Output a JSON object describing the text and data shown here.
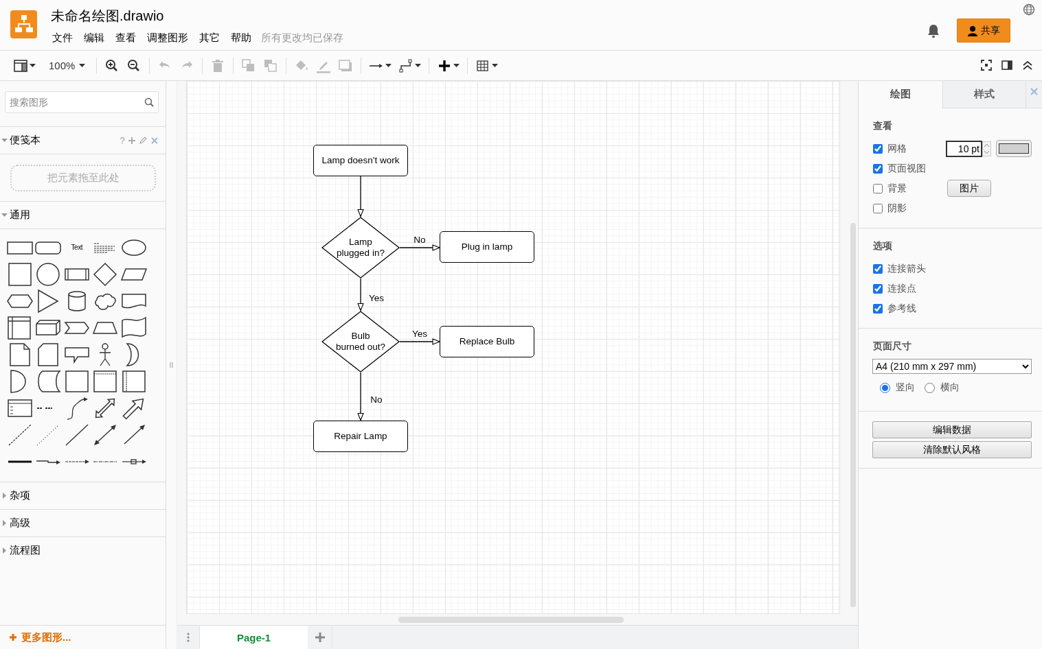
{
  "app": {
    "title": "未命名绘图.drawio",
    "menu": [
      "文件",
      "编辑",
      "查看",
      "调整图形",
      "其它",
      "帮助"
    ],
    "save_status": "所有更改均已保存",
    "share_button": "共享"
  },
  "toolbar": {
    "groups": [
      [
        {
          "kind": "layout",
          "disabled": false
        },
        {
          "kind": "zoom",
          "label": "100%",
          "disabled": false
        }
      ],
      [
        {
          "kind": "zoom-in",
          "disabled": false
        },
        {
          "kind": "zoom-out",
          "disabled": false
        }
      ],
      [
        {
          "kind": "undo",
          "disabled": true
        },
        {
          "kind": "redo",
          "disabled": true
        }
      ],
      [
        {
          "kind": "delete",
          "disabled": true
        }
      ],
      [
        {
          "kind": "to-front",
          "disabled": true
        },
        {
          "kind": "to-back",
          "disabled": true
        }
      ],
      [
        {
          "kind": "fill",
          "disabled": true
        },
        {
          "kind": "line-color",
          "disabled": true
        },
        {
          "kind": "shadow",
          "disabled": true
        }
      ],
      [
        {
          "kind": "connection",
          "disabled": false
        },
        {
          "kind": "waypoint",
          "disabled": false
        }
      ],
      [
        {
          "kind": "insert",
          "disabled": false
        }
      ],
      [
        {
          "kind": "table",
          "disabled": false
        }
      ]
    ],
    "right": [
      {
        "kind": "fullscreen",
        "disabled": false
      },
      {
        "kind": "format-toggle",
        "disabled": false
      },
      {
        "kind": "collapse",
        "disabled": false
      }
    ]
  },
  "sidebar": {
    "search_placeholder": "搜索图形",
    "scratchpad": {
      "title": "便笺本",
      "expanded": true,
      "help": "?",
      "drop_hint": "把元素拖至此处"
    },
    "sections": [
      {
        "title": "通用",
        "expanded": true
      },
      {
        "title": "杂项",
        "expanded": false
      },
      {
        "title": "高级",
        "expanded": false
      },
      {
        "title": "流程图",
        "expanded": false
      }
    ],
    "palette_text": "Text",
    "more_shapes": "更多图形..."
  },
  "diagram": {
    "nodes": [
      {
        "kind": "process",
        "label": "Lamp doesn't work"
      },
      {
        "kind": "decision",
        "label": "Lamp\nplugged in?"
      },
      {
        "kind": "process",
        "label": "Plug in lamp"
      },
      {
        "kind": "decision",
        "label": "Bulb\nburned out?"
      },
      {
        "kind": "process",
        "label": "Replace Bulb"
      },
      {
        "kind": "process",
        "label": "Repair Lamp"
      }
    ],
    "edges": [
      {
        "kind": "plain"
      },
      {
        "kind": "labeled",
        "label": "No"
      },
      {
        "kind": "labeled",
        "label": "Yes"
      },
      {
        "kind": "labeled",
        "label": "Yes"
      },
      {
        "kind": "labeled",
        "label": "No"
      }
    ]
  },
  "page_tabs": [
    {
      "label": "Page-1",
      "selected": true
    }
  ],
  "format_panel": {
    "tabs": [
      {
        "label": "绘图",
        "selected": true
      },
      {
        "label": "样式",
        "selected": false
      }
    ],
    "view": {
      "title": "查看",
      "options": [
        {
          "kind": "grid",
          "label": "网格",
          "checked": true,
          "value": "10 pt"
        },
        {
          "kind": "plain",
          "label": "页面视图",
          "checked": true
        },
        {
          "kind": "background",
          "label": "背景",
          "checked": false,
          "button": "图片"
        },
        {
          "kind": "plain",
          "label": "阴影",
          "checked": false
        }
      ]
    },
    "options": {
      "title": "选项",
      "items": [
        {
          "label": "连接箭头",
          "checked": true
        },
        {
          "label": "连接点",
          "checked": true
        },
        {
          "label": "参考线",
          "checked": true
        }
      ]
    },
    "page_size": {
      "title": "页面尺寸",
      "value": "A4 (210 mm x 297 mm)",
      "orientations": [
        {
          "label": "竖向",
          "selected": true
        },
        {
          "label": "横向",
          "selected": false
        }
      ]
    },
    "buttons": [
      "编辑数据",
      "清除默认风格"
    ]
  }
}
